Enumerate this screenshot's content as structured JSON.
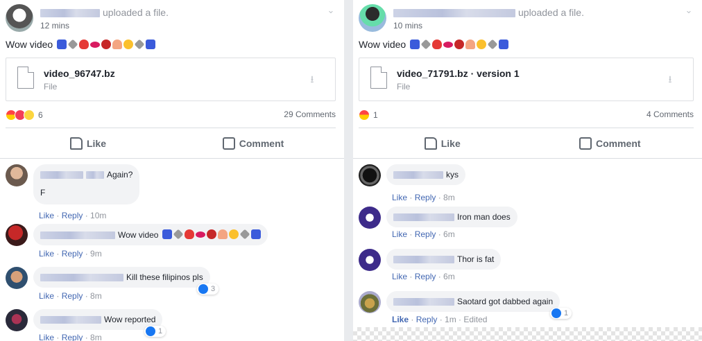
{
  "left_post": {
    "uploaded_text": "uploaded a file.",
    "time": "12 mins",
    "text": "Wow video",
    "file_name": "video_96747.bz",
    "file_type": "File",
    "reaction_count": "6",
    "comment_count": "29 Comments",
    "like_label": "Like",
    "comment_label": "Comment",
    "comments": [
      {
        "text": "Again?",
        "text2": "F",
        "like": "Like",
        "reply": "Reply",
        "time": "10m"
      },
      {
        "text": "Wow video",
        "like": "Like",
        "reply": "Reply",
        "time": "9m"
      },
      {
        "text": "Kill these filipinos pls",
        "like": "Like",
        "reply": "Reply",
        "time": "8m",
        "reactions": "3"
      },
      {
        "text": "Wow reported",
        "like": "Like",
        "reply": "Reply",
        "time": "8m",
        "reactions": "1"
      }
    ]
  },
  "right_post": {
    "uploaded_text": "uploaded a file.",
    "time": "10 mins",
    "text": "Wow video",
    "file_name": "video_71791.bz · version 1",
    "file_type": "File",
    "reaction_count": "1",
    "comment_count": "4 Comments",
    "like_label": "Like",
    "comment_label": "Comment",
    "comments": [
      {
        "text": "kys",
        "like": "Like",
        "reply": "Reply",
        "time": "8m"
      },
      {
        "text": "Iron man does",
        "like": "Like",
        "reply": "Reply",
        "time": "6m"
      },
      {
        "text": "Thor is fat",
        "like": "Like",
        "reply": "Reply",
        "time": "6m"
      },
      {
        "text": "Saotard got dabbed again",
        "like": "Like",
        "reply": "Reply",
        "time": "1m",
        "edited": "Edited",
        "reactions": "1"
      }
    ]
  },
  "icons": [
    "chevron-down-icon",
    "file-icon",
    "download-icon",
    "like-icon",
    "comment-icon",
    "thumbs-up-icon"
  ],
  "colors": {
    "link": "#4267b2",
    "muted": "#90949c",
    "bubble": "#f2f3f5",
    "like_blue": "#1877f2"
  }
}
